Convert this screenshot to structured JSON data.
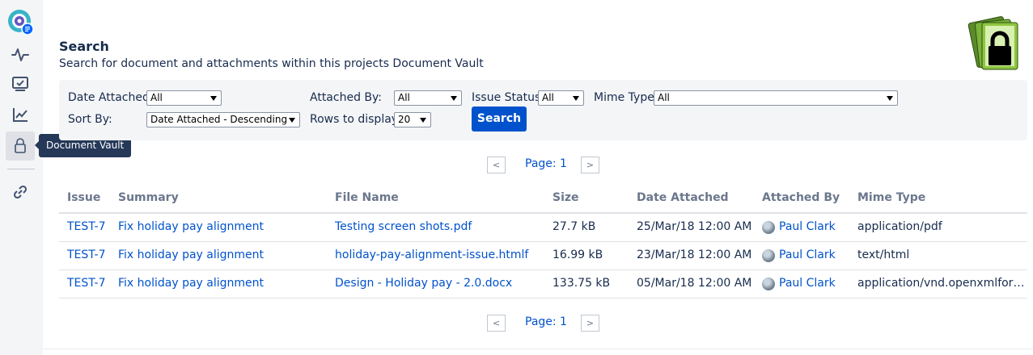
{
  "sidebar": {
    "tooltip": "Document Vault",
    "items": [
      {
        "icon": "app-logo-icon"
      },
      {
        "icon": "activity-icon"
      },
      {
        "icon": "monitor-check-icon"
      },
      {
        "icon": "trend-chart-icon"
      },
      {
        "icon": "lock-icon"
      },
      {
        "icon": "link-icon"
      }
    ]
  },
  "header": {
    "title": "Search",
    "description": "Search for document and attachments within this projects Document Vault"
  },
  "filters": {
    "date_attached": {
      "label": "Date Attached:",
      "value": "All"
    },
    "attached_by": {
      "label": "Attached By:",
      "value": "All"
    },
    "issue_status": {
      "label": "Issue Status:",
      "value": "All"
    },
    "mime_type": {
      "label": "Mime Type:",
      "value": "All"
    },
    "sort_by": {
      "label": "Sort By:",
      "value": "Date Attached - Descending"
    },
    "rows_to_display": {
      "label": "Rows to display:",
      "value": "20"
    },
    "search_button": "Search"
  },
  "pagination": {
    "prev": "<",
    "next": ">",
    "label": "Page: 1"
  },
  "table": {
    "headers": [
      "Issue",
      "Summary",
      "File Name",
      "Size",
      "Date Attached",
      "Attached By",
      "Mime Type"
    ],
    "rows": [
      {
        "issue": "TEST-7",
        "summary": "Fix holiday pay alignment",
        "file": "Testing screen shots.pdf",
        "size": "27.7 kB",
        "date": "25/Mar/18 12:00 AM",
        "by": "Paul Clark",
        "mime": "application/pdf"
      },
      {
        "issue": "TEST-7",
        "summary": "Fix holiday pay alignment",
        "file": "holiday-pay-alignment-issue.htmlf",
        "size": "16.99 kB",
        "date": "23/Mar/18 12:00 AM",
        "by": "Paul Clark",
        "mime": "text/html"
      },
      {
        "issue": "TEST-7",
        "summary": "Fix holiday pay alignment",
        "file": "Design - Holiday pay - 2.0.docx",
        "size": "133.75 kB",
        "date": "05/Mar/18 12:00 AM",
        "by": "Paul Clark",
        "mime": "application/vnd.openxmlfor…"
      }
    ]
  },
  "colors": {
    "accent": "#0052cc",
    "link": "#0052cc",
    "panel": "#f4f5f7"
  }
}
